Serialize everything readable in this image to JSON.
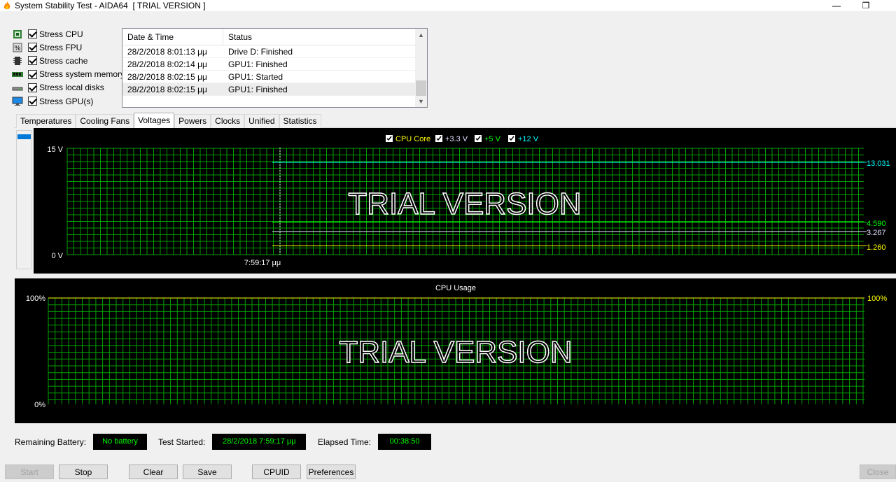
{
  "window": {
    "title": "System Stability Test - AIDA64  [ TRIAL VERSION ]",
    "minimize_label": "—",
    "restore_label": "❐"
  },
  "stress": [
    {
      "label": "Stress CPU",
      "icon": "cpu-icon",
      "checked": true
    },
    {
      "label": "Stress FPU",
      "icon": "fpu-icon",
      "checked": true
    },
    {
      "label": "Stress cache",
      "icon": "cache-icon",
      "checked": true
    },
    {
      "label": "Stress system memory",
      "icon": "memory-icon",
      "checked": true
    },
    {
      "label": "Stress local disks",
      "icon": "disk-icon",
      "checked": true
    },
    {
      "label": "Stress GPU(s)",
      "icon": "monitor-icon",
      "checked": true
    }
  ],
  "log": {
    "headers": [
      "Date & Time",
      "Status"
    ],
    "rows": [
      {
        "time": "28/2/2018 8:01:13 μμ",
        "status": "Drive D: Finished"
      },
      {
        "time": "28/2/2018 8:02:14 μμ",
        "status": "GPU1: Finished"
      },
      {
        "time": "28/2/2018 8:02:15 μμ",
        "status": "GPU1: Started"
      },
      {
        "time": "28/2/2018 8:02:15 μμ",
        "status": "GPU1: Finished"
      }
    ]
  },
  "tabs": [
    {
      "label": "Temperatures",
      "active": false
    },
    {
      "label": "Cooling Fans",
      "active": false
    },
    {
      "label": "Voltages",
      "active": true
    },
    {
      "label": "Powers",
      "active": false
    },
    {
      "label": "Clocks",
      "active": false
    },
    {
      "label": "Unified",
      "active": false
    },
    {
      "label": "Statistics",
      "active": false
    }
  ],
  "voltage_chart": {
    "legend": [
      {
        "label": "CPU Core",
        "color": "#ffff00",
        "checked": true
      },
      {
        "label": "+3.3 V",
        "color": "#e0e0ff",
        "checked": true
      },
      {
        "label": "+5 V",
        "color": "#00ff00",
        "checked": true
      },
      {
        "label": "+12 V",
        "color": "#00ffff",
        "checked": true
      }
    ],
    "y_max_label": "15 V",
    "y_min_label": "0 V",
    "x_marker_label": "7:59:17 μμ",
    "watermark": "TRIAL VERSION",
    "readouts": [
      "13.031",
      "4.590",
      "3.267",
      "1.260"
    ]
  },
  "chart_data": [
    {
      "type": "line",
      "title": "",
      "ylim": [
        0,
        15
      ],
      "ylabel_top": "15 V",
      "ylabel_bottom": "0 V",
      "x_marker": "7:59:17 μμ",
      "series": [
        {
          "name": "CPU Core",
          "color": "#ffff00",
          "current": 1.26
        },
        {
          "name": "+3.3 V",
          "color": "#e0e0ff",
          "current": 3.267
        },
        {
          "name": "+5 V",
          "color": "#00ff00",
          "current": 4.59
        },
        {
          "name": "+12 V",
          "color": "#00ffff",
          "current": 13.031
        }
      ]
    },
    {
      "type": "line",
      "title": "CPU Usage",
      "ylim": [
        0,
        100
      ],
      "ylabel_top": "100%",
      "ylabel_bottom": "0%",
      "right_readout": "100%",
      "series": [
        {
          "name": "",
          "color": "#ffff00",
          "current": 100
        }
      ]
    }
  ],
  "cpu_chart": {
    "title": "CPU Usage",
    "y_max_label": "100%",
    "y_min_label": "0%",
    "right_readout": "100%",
    "watermark": "TRIAL VERSION"
  },
  "status": {
    "battery_label": "Remaining Battery:",
    "battery_value": "No battery",
    "started_label": "Test Started:",
    "started_value": "28/2/2018 7:59:17 μμ",
    "elapsed_label": "Elapsed Time:",
    "elapsed_value": "00:38:50"
  },
  "buttons": {
    "start": "Start",
    "stop": "Stop",
    "clear": "Clear",
    "save": "Save",
    "cpuid": "CPUID",
    "preferences": "Preferences",
    "close": "Close"
  },
  "colors": {
    "grid": "#00a000",
    "cpu_core": "#ffff00",
    "v33": "#e0e0ff",
    "v5": "#00ff00",
    "v12": "#00ffff",
    "accent": "#0078d7"
  }
}
